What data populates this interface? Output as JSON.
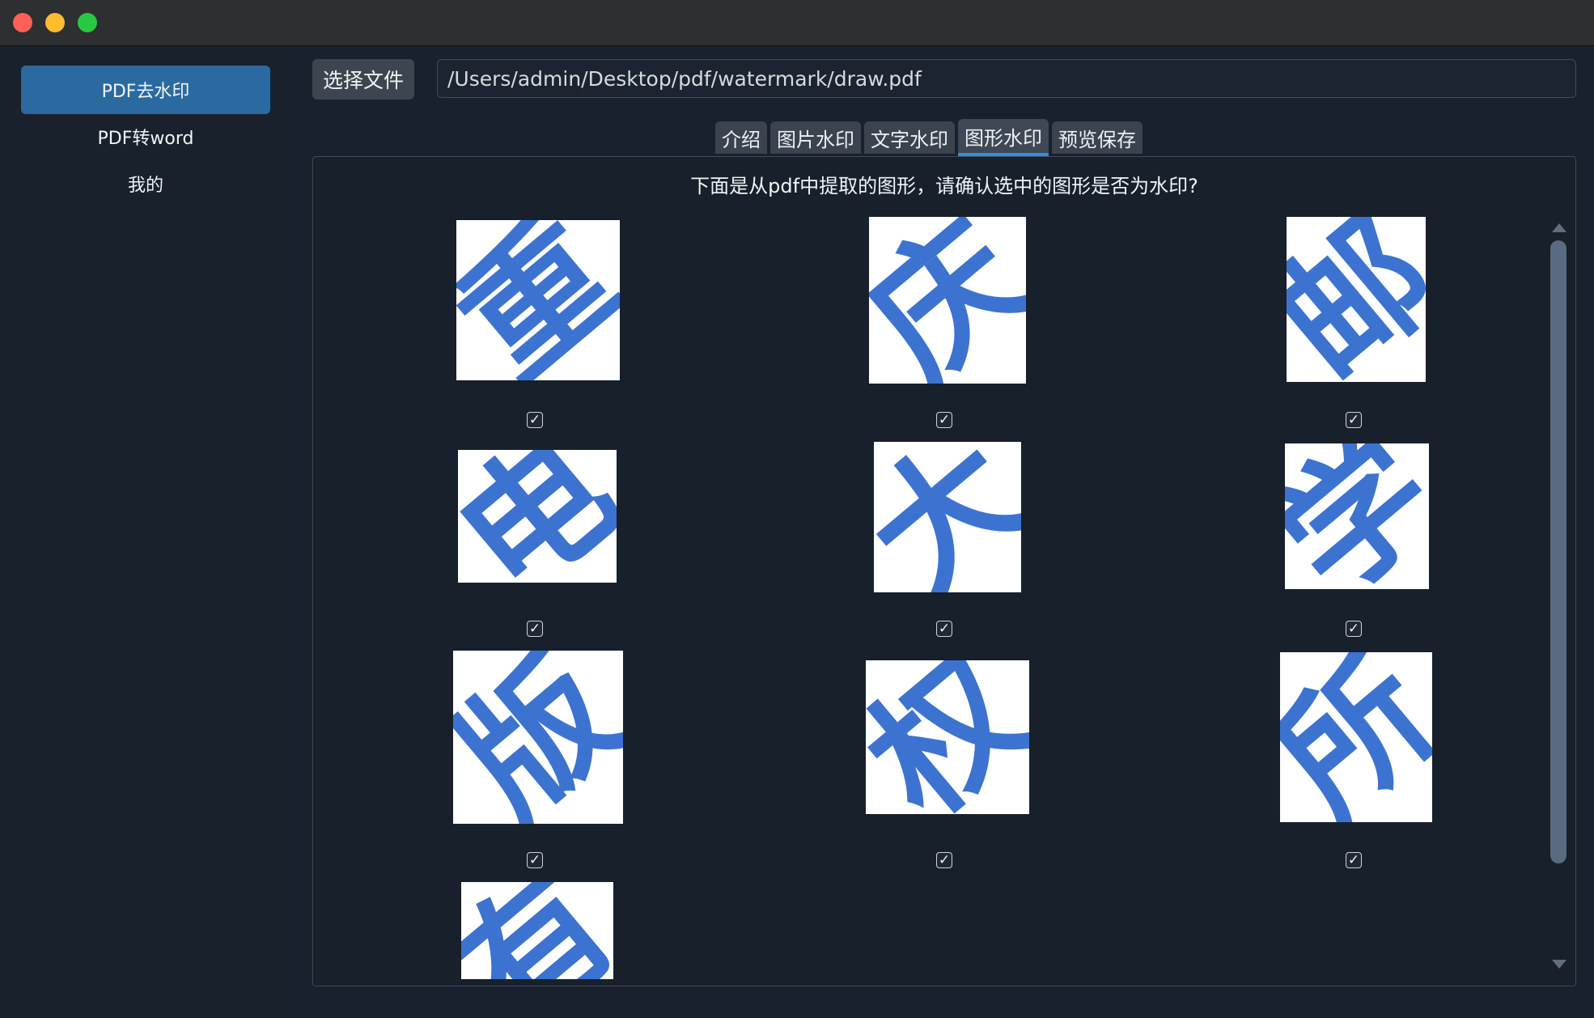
{
  "sidebar": {
    "items": [
      {
        "label": "PDF去水印"
      },
      {
        "label": "PDF转word"
      },
      {
        "label": "我的"
      }
    ]
  },
  "toolbar": {
    "choose_file_label": "选择文件",
    "file_path": "/Users/admin/Desktop/pdf/watermark/draw.pdf"
  },
  "tabs": [
    {
      "label": "介绍"
    },
    {
      "label": "图片水印"
    },
    {
      "label": "文字水印"
    },
    {
      "label": "图形水印"
    },
    {
      "label": "预览保存"
    }
  ],
  "panel": {
    "prompt": "下面是从pdf中提取的图形，请确认选中的图形是否为水印?",
    "shapes": [
      {
        "char": "重",
        "checked": true
      },
      {
        "char": "庆",
        "checked": true
      },
      {
        "char": "邮",
        "checked": true
      },
      {
        "char": "电",
        "checked": true
      },
      {
        "char": "大",
        "checked": true
      },
      {
        "char": "学",
        "checked": true
      },
      {
        "char": "版",
        "checked": true
      },
      {
        "char": "权",
        "checked": true
      },
      {
        "char": "所",
        "checked": true
      },
      {
        "char": "有",
        "checked": false
      }
    ],
    "check_glyph": "✓"
  },
  "colors": {
    "accent": "#2a6aa0",
    "tab_indicator": "#2f8fe0",
    "watermark_blue": "#3d73d0"
  }
}
